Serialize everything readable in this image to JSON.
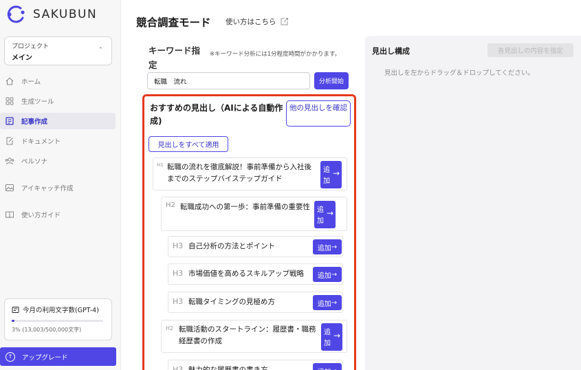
{
  "app": {
    "name": "SAKUBUN",
    "brand_color": "#4f46e5",
    "highlight_color": "#e5391c"
  },
  "sidebar": {
    "project": {
      "label": "プロジェクト",
      "value": "メイン"
    },
    "items": [
      {
        "label": "ホーム",
        "icon": "home-icon"
      },
      {
        "label": "生成ツール",
        "icon": "grid-icon"
      },
      {
        "label": "記事作成",
        "icon": "article-icon",
        "active": true
      },
      {
        "label": "ドキュメント",
        "icon": "edit-document-icon"
      },
      {
        "label": "ペルソナ",
        "icon": "persona-icon"
      },
      {
        "label": "アイキャッチ作成",
        "icon": "image-icon"
      },
      {
        "label": "使い方ガイド",
        "icon": "book-icon"
      }
    ],
    "usage": {
      "title": "今月の利用文字数(GPT-4)",
      "text": "3% (13,003/500,000文字)",
      "percent": 3
    },
    "upgrade_label": "アップグレード"
  },
  "main": {
    "title": "競合調査モード",
    "howto_link": "使い方はこちら",
    "keyword": {
      "label": "キーワード指定",
      "note": "※キーワード分析には1分程度時間がかかります。",
      "value": "転職　流れ",
      "button": "分析開始"
    },
    "recommended": {
      "title": "おすすめの見出し（AIによる自動作成)",
      "other_button": "他の見出しを確認",
      "apply_all_button": "見出しをすべて適用",
      "add_label_1": "追",
      "add_label_2": "加",
      "add_label": "追加",
      "arrow": "→",
      "headings": [
        {
          "level": "H1",
          "text": "転職の流れを徹底解説！事前準備から入社後までのステップバイステップガイド"
        },
        {
          "level": "H2",
          "text": "転職成功への第一歩：事前準備の重要性"
        },
        {
          "level": "H3",
          "text": "自己分析の方法とポイント"
        },
        {
          "level": "H3",
          "text": "市場価値を高めるスキルアップ戦略"
        },
        {
          "level": "H3",
          "text": "転職タイミングの見極め方"
        },
        {
          "level": "H2",
          "text": "転職活動のスタートライン：履歴書・職務経歴書の作成"
        },
        {
          "level": "H3",
          "text": "魅力的な履歴書の書き方"
        }
      ]
    }
  },
  "right_panel": {
    "title": "見出し構成",
    "button": "各見出しの内容を指定",
    "hint": "見出しを左からドラッグ＆ドロップしてください。"
  }
}
